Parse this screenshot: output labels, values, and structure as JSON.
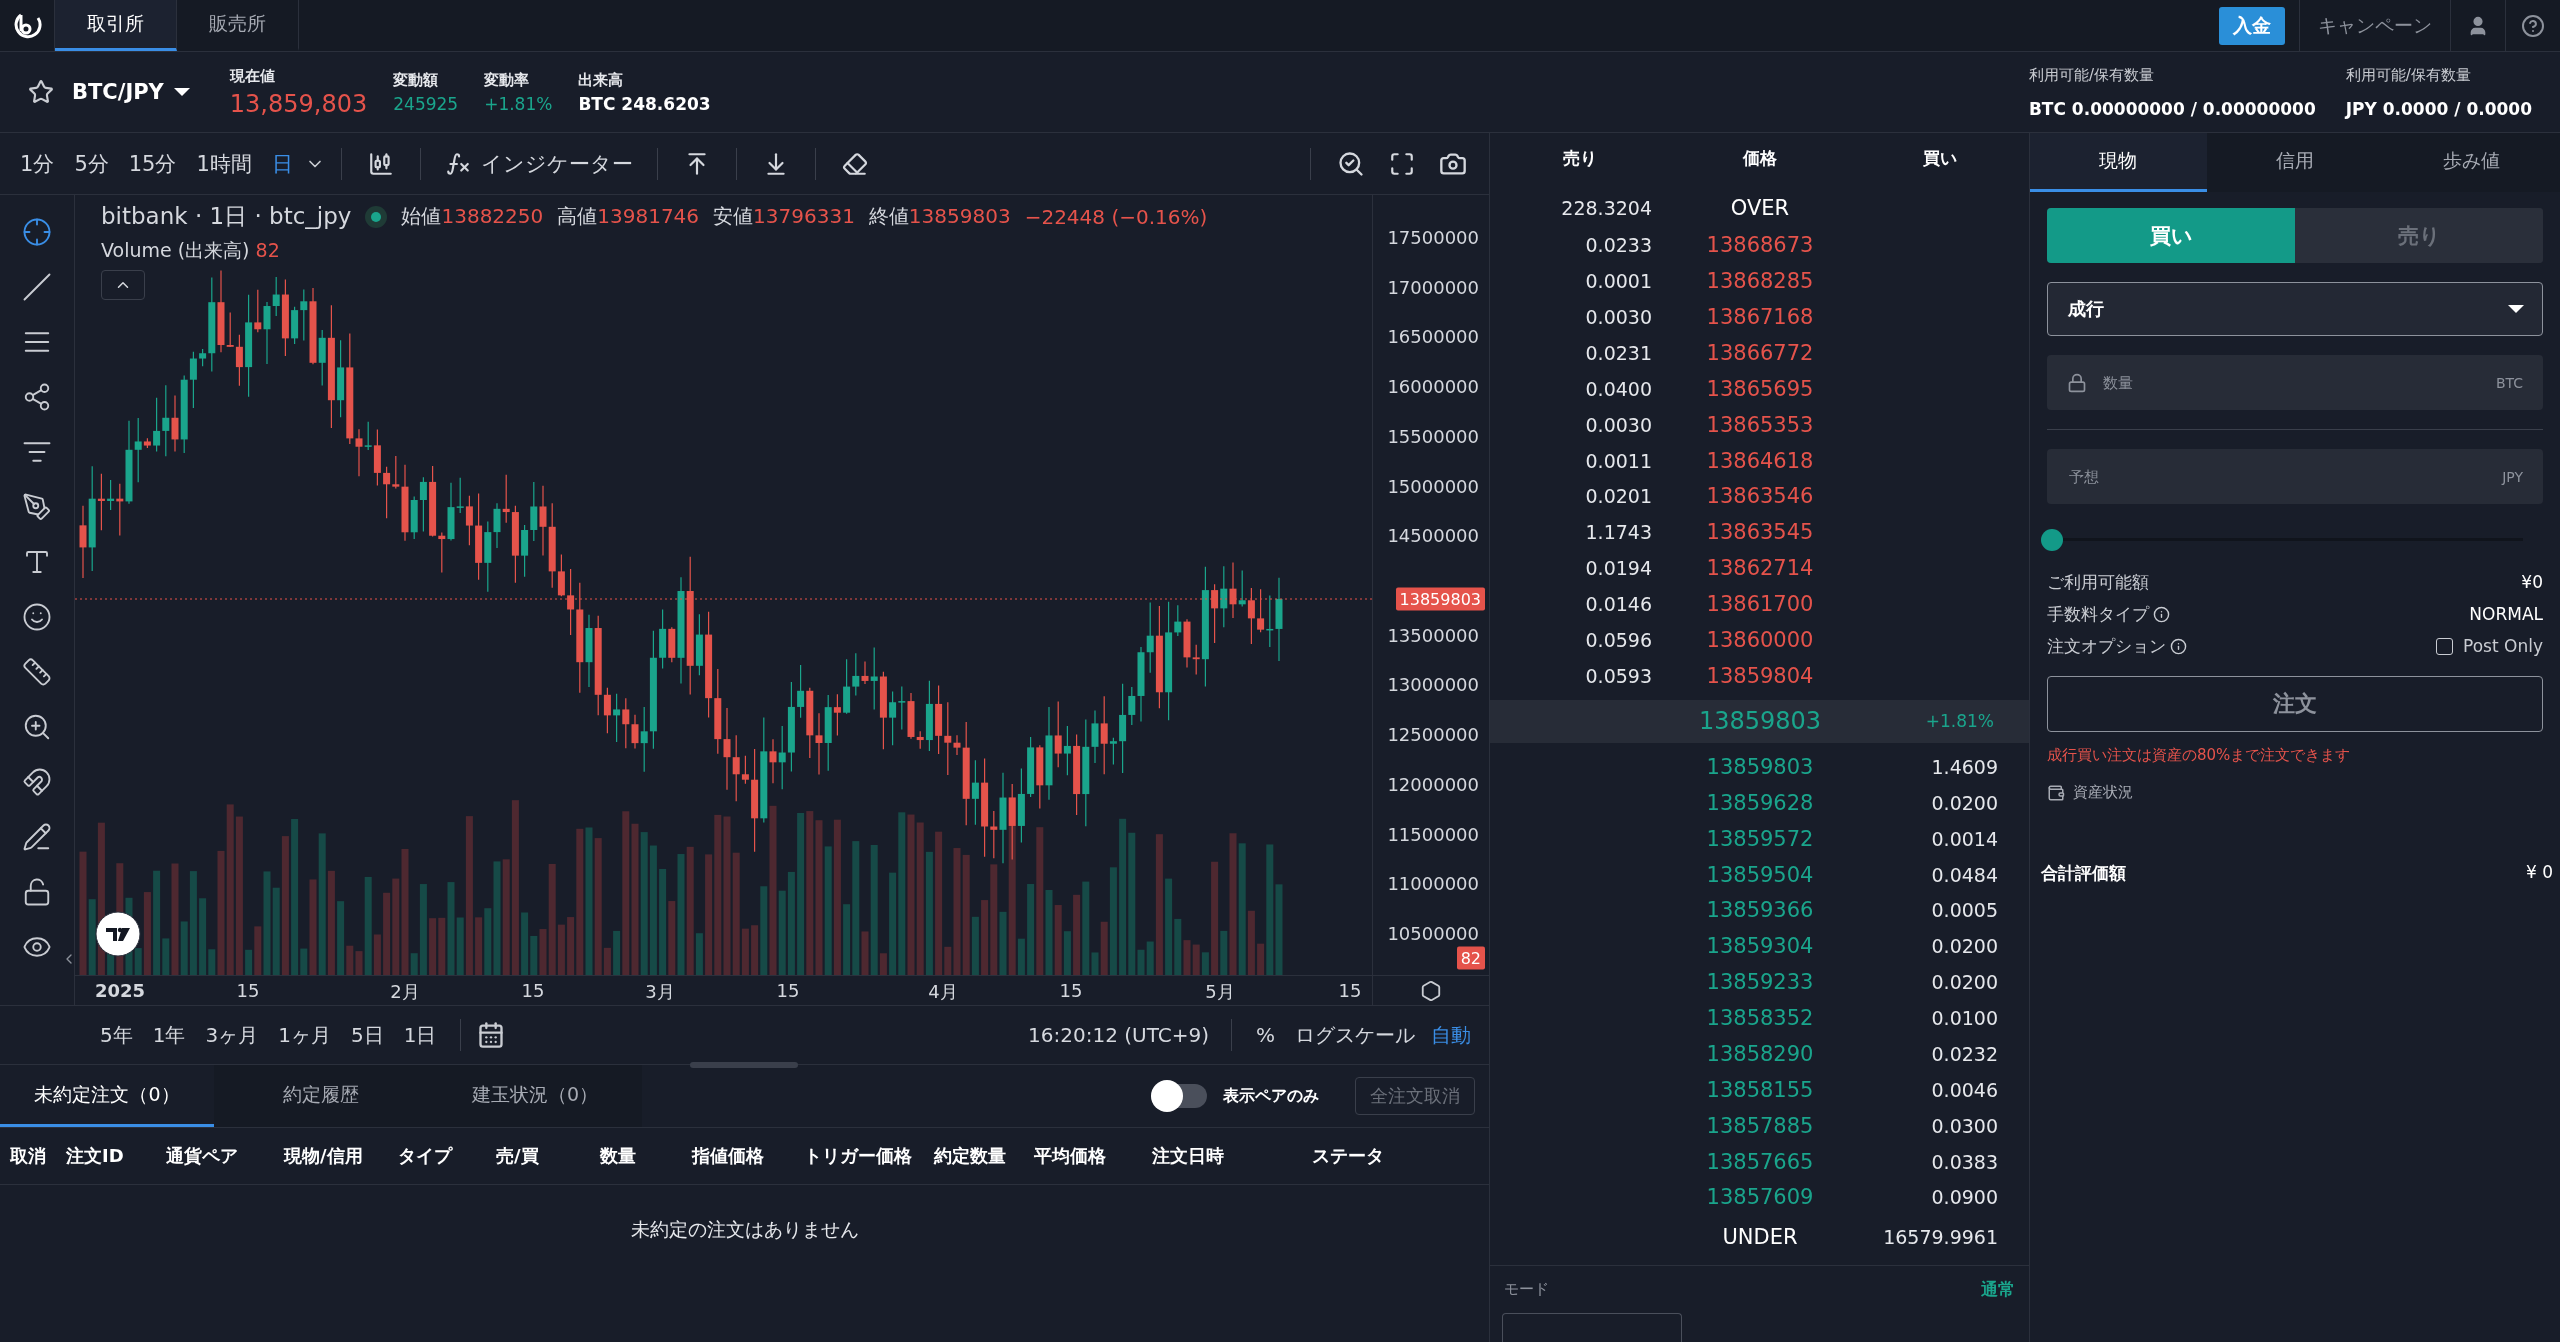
{
  "header": {
    "tabs": [
      {
        "label": "取引所",
        "selected": true
      },
      {
        "label": "販売所",
        "selected": false
      }
    ],
    "deposit_button": "入金",
    "campaign_link": "キャンペーン"
  },
  "ticker": {
    "pair": "BTC/JPY",
    "stats": [
      {
        "label": "現在値",
        "value": "13,859,803",
        "kind": "price"
      },
      {
        "label": "変動額",
        "value": "245925",
        "kind": "up"
      },
      {
        "label": "変動率",
        "value": "+1.81%",
        "kind": "up"
      },
      {
        "label": "出来高",
        "value": "BTC 248.6203",
        "kind": "plain"
      }
    ],
    "balances": [
      {
        "label": "利用可能/保有数量",
        "value": "BTC 0.00000000 / 0.00000000"
      },
      {
        "label": "利用可能/保有数量",
        "value": "JPY 0.0000 / 0.0000"
      }
    ]
  },
  "chart_toolbar": {
    "intervals": [
      {
        "label": "1分",
        "selected": false
      },
      {
        "label": "5分",
        "selected": false
      },
      {
        "label": "15分",
        "selected": false
      },
      {
        "label": "1時間",
        "selected": false
      },
      {
        "label": "日",
        "selected": true
      }
    ],
    "indicator_button": "インジケーター"
  },
  "tools": [
    {
      "kind": "crosshair",
      "selected": true
    },
    {
      "kind": "line",
      "selected": false
    },
    {
      "kind": "lines",
      "selected": false
    },
    {
      "kind": "pattern",
      "selected": false
    },
    {
      "kind": "fib",
      "selected": false
    },
    {
      "kind": "brush",
      "selected": false
    },
    {
      "kind": "text",
      "selected": false
    },
    {
      "kind": "emoji",
      "selected": false
    },
    {
      "kind": "ruler",
      "selected": false
    },
    {
      "kind": "zoom",
      "selected": false
    },
    {
      "kind": "magnet",
      "selected": false
    },
    {
      "kind": "pencil",
      "selected": false
    },
    {
      "kind": "lock",
      "selected": false
    },
    {
      "kind": "eye",
      "selected": false
    }
  ],
  "chart": {
    "legend_title": "bitbank · 1日 · btc_jpy",
    "ohlc": [
      {
        "label": "始値",
        "value": "13882250"
      },
      {
        "label": "高値",
        "value": "13981746"
      },
      {
        "label": "安値",
        "value": "13796331"
      },
      {
        "label": "終値",
        "value": "13859803"
      }
    ],
    "change": "−22448 (−0.16%)",
    "volume_label": "Volume (出来高)",
    "volume_value": "82",
    "price_ticks_upper": [
      "17500000",
      "17000000",
      "16500000",
      "16000000",
      "15500000",
      "15000000",
      "14500000"
    ],
    "price_ticks_lower": [
      "13500000",
      "13000000",
      "12500000",
      "12000000",
      "11500000",
      "11000000",
      "10500000"
    ],
    "last_price_label": "13859803",
    "volume_axis_label": "82",
    "time_ticks": [
      "2025",
      "15",
      "2月",
      "15",
      "3月",
      "15",
      "4月",
      "15",
      "5月",
      "15"
    ]
  },
  "range_bar": {
    "ranges": [
      "5年",
      "1年",
      "3ヶ月",
      "1ヶ月",
      "5日",
      "1日"
    ],
    "time": "16:20:12 (UTC+9)",
    "percent": "%",
    "log_scale": "ログスケール",
    "auto": {
      "label": "自動",
      "on": true
    }
  },
  "orders": {
    "tabs": [
      {
        "label": "未約定注文（0）",
        "selected": true
      },
      {
        "label": "約定履歴",
        "selected": false
      },
      {
        "label": "建玉状況（0）",
        "selected": false
      }
    ],
    "pair_filter": {
      "label": "表示ペアのみ",
      "on": false
    },
    "cancel_all_button": {
      "label": "全注文取消",
      "disabled": true
    },
    "columns": [
      "取消",
      "注文ID",
      "通貨ペア",
      "現物/信用",
      "タイプ",
      "売/買",
      "数量",
      "指値価格",
      "トリガー価格",
      "約定数量",
      "平均価格",
      "注文日時",
      "ステータ"
    ],
    "empty_message": "未約定の注文はありません"
  },
  "order_book": {
    "columns": [
      "売り",
      "価格",
      "買い"
    ],
    "over": {
      "label": "OVER",
      "amount": "228.3204"
    },
    "asks": [
      {
        "amount": "0.0233",
        "price": "13868673"
      },
      {
        "amount": "0.0001",
        "price": "13868285"
      },
      {
        "amount": "0.0030",
        "price": "13867168"
      },
      {
        "amount": "0.0231",
        "price": "13866772"
      },
      {
        "amount": "0.0400",
        "price": "13865695"
      },
      {
        "amount": "0.0030",
        "price": "13865353"
      },
      {
        "amount": "0.0011",
        "price": "13864618"
      },
      {
        "amount": "0.0201",
        "price": "13863546"
      },
      {
        "amount": "1.1743",
        "price": "13863545"
      },
      {
        "amount": "0.0194",
        "price": "13862714"
      },
      {
        "amount": "0.0146",
        "price": "13861700"
      },
      {
        "amount": "0.0596",
        "price": "13860000"
      },
      {
        "amount": "0.0593",
        "price": "13859804"
      }
    ],
    "last": {
      "price": "13859803",
      "change": "+1.81%"
    },
    "bids": [
      {
        "price": "13859803",
        "amount": "1.4609"
      },
      {
        "price": "13859628",
        "amount": "0.0200"
      },
      {
        "price": "13859572",
        "amount": "0.0014"
      },
      {
        "price": "13859504",
        "amount": "0.0484"
      },
      {
        "price": "13859366",
        "amount": "0.0005"
      },
      {
        "price": "13859304",
        "amount": "0.0200"
      },
      {
        "price": "13859233",
        "amount": "0.0200"
      },
      {
        "price": "13858352",
        "amount": "0.0100"
      },
      {
        "price": "13858290",
        "amount": "0.0232"
      },
      {
        "price": "13858155",
        "amount": "0.0046"
      },
      {
        "price": "13857885",
        "amount": "0.0300"
      },
      {
        "price": "13857665",
        "amount": "0.0383"
      },
      {
        "price": "13857609",
        "amount": "0.0900"
      }
    ],
    "under": {
      "label": "UNDER",
      "amount": "16579.9961"
    },
    "mode": {
      "label": "モード",
      "value": "通常"
    }
  },
  "order_form": {
    "tabs": [
      {
        "label": "現物",
        "selected": true
      },
      {
        "label": "信用",
        "selected": false
      },
      {
        "label": "歩み値",
        "selected": false
      }
    ],
    "sides": [
      {
        "label": "買い",
        "selected": true
      },
      {
        "label": "売り",
        "selected": false
      }
    ],
    "order_type": "成行",
    "amount_field": {
      "placeholder": "数量",
      "unit": "BTC"
    },
    "estimate_field": {
      "placeholder": "予想",
      "unit": "JPY"
    },
    "slider": {
      "level": 0
    },
    "rows": [
      {
        "kind": "text",
        "label": "ご利用可能額",
        "value": "¥0"
      },
      {
        "kind": "info",
        "label": "手数料タイプ",
        "value": "NORMAL"
      },
      {
        "kind": "checkbox",
        "label": "注文オプション",
        "value": "Post Only",
        "checked": false
      }
    ],
    "submit_button": {
      "label": "注文",
      "disabled": true
    },
    "warning": "成行買い注文は資産の80%まで注文できます",
    "assets_link": "資産状況",
    "total": {
      "label": "合計評価額",
      "value": "¥ 0"
    }
  }
}
